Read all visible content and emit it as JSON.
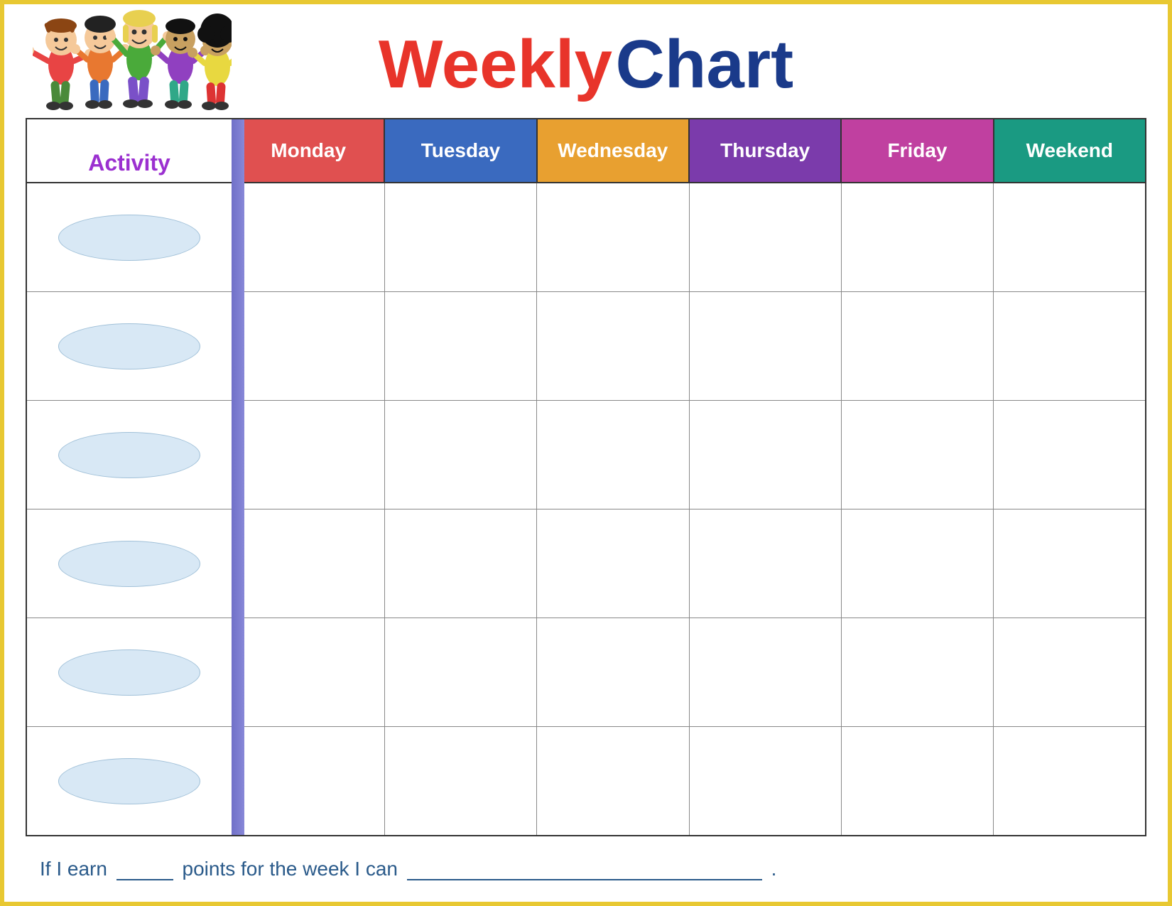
{
  "title": {
    "weekly": "Weekly",
    "chart": "Chart"
  },
  "table": {
    "activity_label": "Activity",
    "days": [
      {
        "id": "monday",
        "label": "Monday",
        "color_class": "day-monday"
      },
      {
        "id": "tuesday",
        "label": "Tuesday",
        "color_class": "day-tuesday"
      },
      {
        "id": "wednesday",
        "label": "Wednesday",
        "color_class": "day-wednesday"
      },
      {
        "id": "thursday",
        "label": "Thursday",
        "color_class": "day-thursday"
      },
      {
        "id": "friday",
        "label": "Friday",
        "color_class": "day-friday"
      },
      {
        "id": "weekend",
        "label": "Weekend",
        "color_class": "day-weekend"
      }
    ],
    "rows": 6
  },
  "bottom_text": {
    "part1": "If I earn",
    "part2": "points for the week I can",
    "period": "."
  }
}
